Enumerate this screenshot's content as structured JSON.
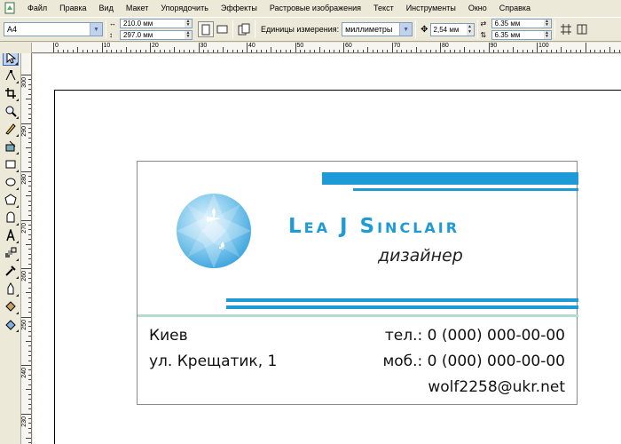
{
  "menu": [
    "Файл",
    "Правка",
    "Вид",
    "Макет",
    "Упорядочить",
    "Эффекты",
    "Растровые изображения",
    "Текст",
    "Инструменты",
    "Окно",
    "Справка"
  ],
  "property_bar": {
    "paper_preset": "A4",
    "width": "210.0 мм",
    "height": "297.0 мм",
    "units_label": "Единицы измерения:",
    "units_value": "миллиметры",
    "nudge": "2,54 мм",
    "dup_x": "6.35 мм",
    "dup_y": "6.35 мм"
  },
  "ruler": {
    "h_labels": [
      "0",
      "10",
      "20",
      "30",
      "40",
      "50",
      "60",
      "70",
      "80",
      "90",
      "100"
    ],
    "v_labels": [
      "300",
      "290",
      "280",
      "270",
      "260",
      "250",
      "240",
      "230"
    ]
  },
  "card": {
    "name": "Lea J Sinclair",
    "title": "дизайнер",
    "city": "Киев",
    "street": "ул. Крещатик, 1",
    "phone": "тел.: 0 (000) 000-00-00",
    "mobile": "моб.: 0 (000) 000-00-00",
    "email": "wolf2258@ukr.net",
    "accent_color": "#1e9ad6",
    "divider_color": "#b4dccf"
  }
}
